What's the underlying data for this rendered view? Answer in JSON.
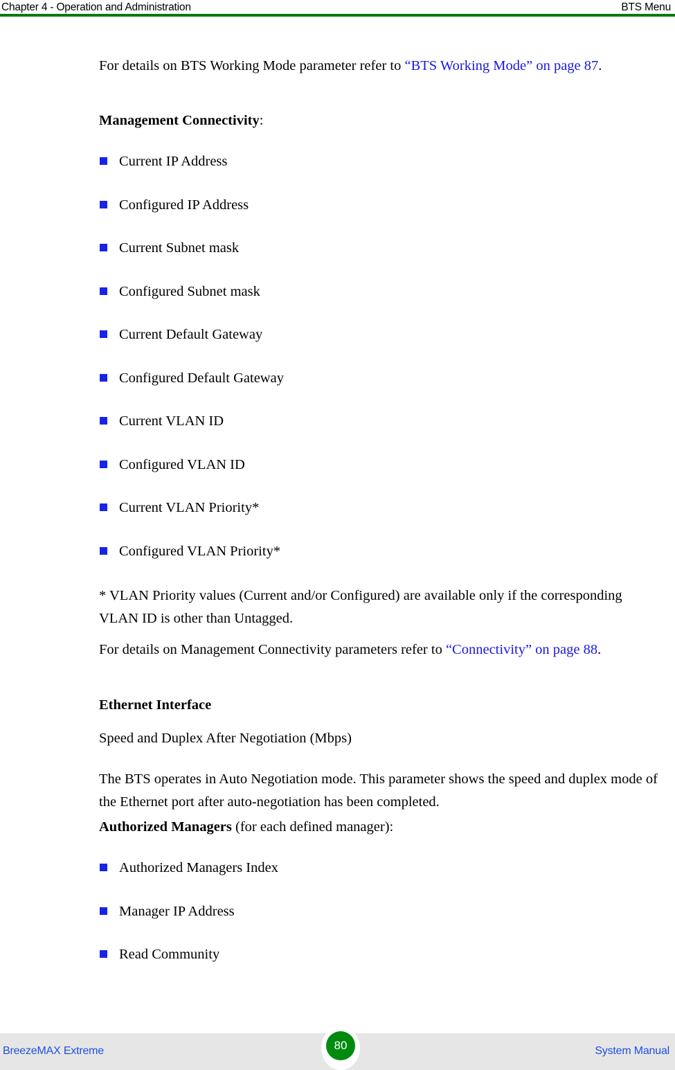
{
  "header": {
    "left": "Chapter 4 - Operation and Administration",
    "right": "BTS Menu",
    "rule_color": "#087c08"
  },
  "body": {
    "intro_paragraph": {
      "prefix": "For details on BTS Working Mode parameter refer to ",
      "link": "“BTS Working Mode” on page 87",
      "suffix": "."
    },
    "management_heading": {
      "bold": "Management Connectivity",
      "normal": ":"
    },
    "management_bullets": [
      "Current IP Address",
      "Configured IP Address",
      "Current Subnet mask",
      "Configured Subnet mask",
      "Current Default Gateway",
      "Configured Default Gateway",
      "Current VLAN ID",
      "Configured VLAN ID",
      "Current VLAN Priority*",
      "Configured VLAN Priority*"
    ],
    "footnote": "* VLAN Priority values (Current and/or Configured) are available only if the corresponding VLAN ID is other than Untagged.",
    "connectivity_paragraph": {
      "prefix": "For details on Management Connectivity parameters refer to ",
      "link": "“Connectivity” on page 88",
      "suffix": "."
    },
    "ethernet_heading": "Ethernet Interface",
    "ethernet_subtitle": "Speed and Duplex After Negotiation (Mbps)",
    "ethernet_paragraph": "The BTS operates in Auto Negotiation mode. This parameter shows the speed and duplex mode of the Ethernet port after auto-negotiation has been completed.",
    "managers_heading": {
      "bold": "Authorized Managers",
      "normal": " (for each defined manager):"
    },
    "managers_bullets": [
      "Authorized Managers Index",
      "Manager IP Address",
      "Read Community"
    ],
    "bullet_color": "#1823e8",
    "link_color": "#1818e0"
  },
  "footer": {
    "left": "BreezeMAX Extreme",
    "right": "System Manual",
    "page_number": "80",
    "badge_color": "#008a0e",
    "band_color": "#e6e6e6",
    "text_color": "#1f4fe0"
  }
}
